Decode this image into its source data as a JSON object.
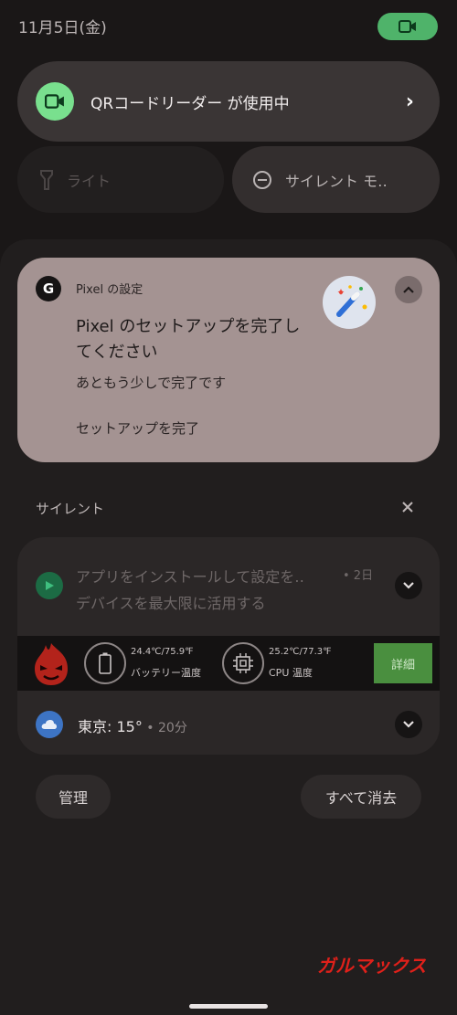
{
  "status": {
    "date": "11月5日(金)"
  },
  "camera_indicator": {
    "text": "QRコードリーダー が使用中",
    "accent": "#79e08e"
  },
  "quick_tiles": [
    {
      "label": "ライト",
      "icon": "flashlight-icon",
      "active": false
    },
    {
      "label": "サイレント モ‥",
      "icon": "do-not-disturb-icon",
      "active": true
    }
  ],
  "pixel_notification": {
    "app": "Pixel の設定",
    "title": "Pixel のセットアップを完了してください",
    "body": "あともう少しで完了です",
    "action": "セットアップを完了",
    "background": "#a49392"
  },
  "silent_section": {
    "header": "サイレント",
    "notifications": {
      "play": {
        "title": "アプリをインストールして設定を‥",
        "time": "• 2日",
        "subtitle": "デバイスを最大限に活用する"
      },
      "antutu": {
        "battery_temp": "24.4℃/75.9℉",
        "battery_label": "バッテリー温度",
        "cpu_temp": "25.2℃/77.3℉",
        "cpu_label": "CPU 温度",
        "detail_button": "詳細"
      },
      "weather": {
        "text": "東京: 15°",
        "time": " • 20分"
      }
    }
  },
  "footer": {
    "manage": "管理",
    "clear_all": "すべて消去"
  },
  "watermark": "ガルマックス"
}
